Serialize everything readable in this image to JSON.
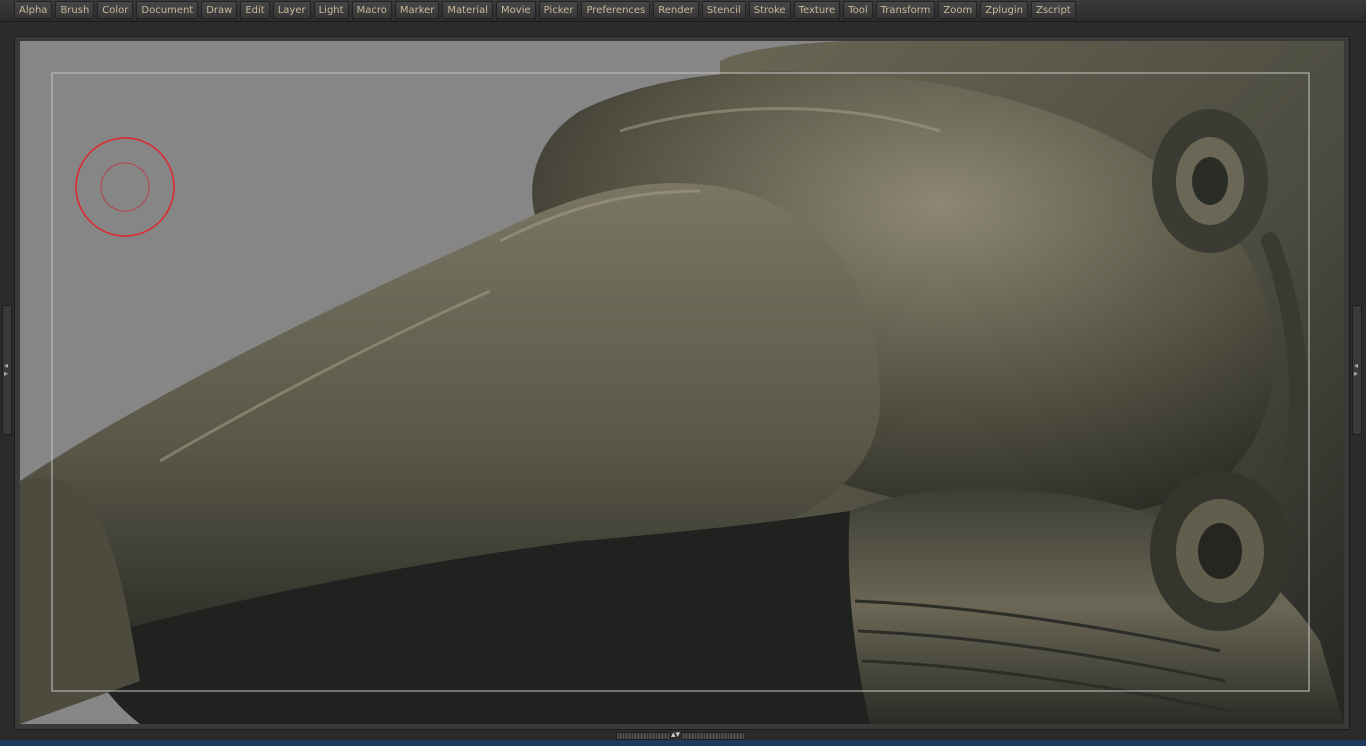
{
  "menu": {
    "items": [
      "Alpha",
      "Brush",
      "Color",
      "Document",
      "Draw",
      "Edit",
      "Layer",
      "Light",
      "Macro",
      "Marker",
      "Material",
      "Movie",
      "Picker",
      "Preferences",
      "Render",
      "Stencil",
      "Stroke",
      "Texture",
      "Tool",
      "Transform",
      "Zoom",
      "Zplugin",
      "Zscript"
    ]
  },
  "canvas": {
    "background_color": "#868686",
    "model_color": "#5a5647",
    "brush_cursor_color": "#e2262d"
  },
  "icons": {
    "left_handle": "left-right-arrow-icon",
    "right_handle": "left-right-arrow-icon",
    "bottom_handle": "up-down-arrow-icon"
  }
}
